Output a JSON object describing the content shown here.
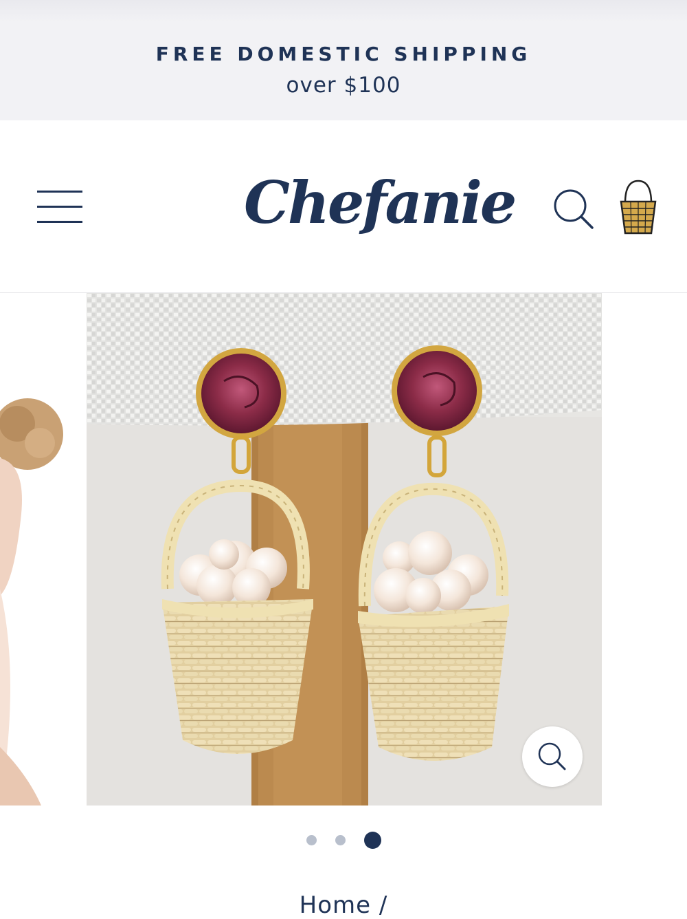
{
  "announcement": {
    "line1": "FREE DOMESTIC SHIPPING",
    "line2": "over $100"
  },
  "header": {
    "logo_text": "Chefanie",
    "menu_icon": "hamburger-menu-icon",
    "search_icon": "search-icon",
    "cart_icon": "basket-cart-icon"
  },
  "carousel": {
    "total_slides": 3,
    "active_slide": 3,
    "zoom_icon": "magnifier-icon"
  },
  "breadcrumb": {
    "home_label": "Home",
    "separator": "/"
  },
  "colors": {
    "brand_navy": "#1f3356",
    "dot_inactive": "#b8bfcc",
    "banner_bg": "#f2f2f5"
  }
}
